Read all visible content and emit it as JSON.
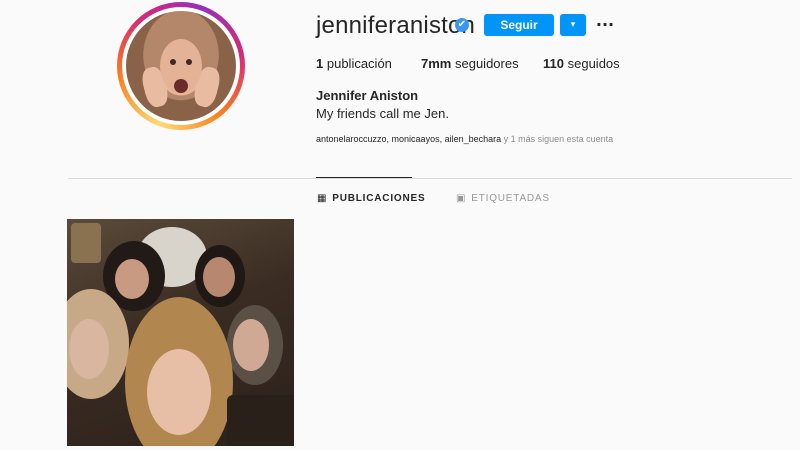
{
  "profile": {
    "username": "jenniferaniston",
    "verified_icon": "✔",
    "follow_label": "Seguir",
    "dropdown_icon": "▾",
    "more_icon": "···",
    "stats": {
      "posts_count": "1",
      "posts_label": "publicación",
      "followers_count": "7mm",
      "followers_label": "seguidores",
      "following_count": "110",
      "following_label": "seguidos"
    },
    "full_name": "Jennifer Aniston",
    "bio": "My friends call me Jen.",
    "followed_by_users": "antonelaroccuzzo, monicaayos, ailen_bechara",
    "followed_by_suffix": " y 1 más siguen esta cuenta"
  },
  "tabs": [
    {
      "label": "PUBLICACIONES",
      "icon": "grid-icon",
      "active": true
    },
    {
      "label": "ETIQUETADAS",
      "icon": "tagged-icon",
      "active": false
    }
  ],
  "colors": {
    "accent": "#0095f6",
    "verified": "#3897f0",
    "muted": "#8e8e8e",
    "background": "#fafafa"
  }
}
